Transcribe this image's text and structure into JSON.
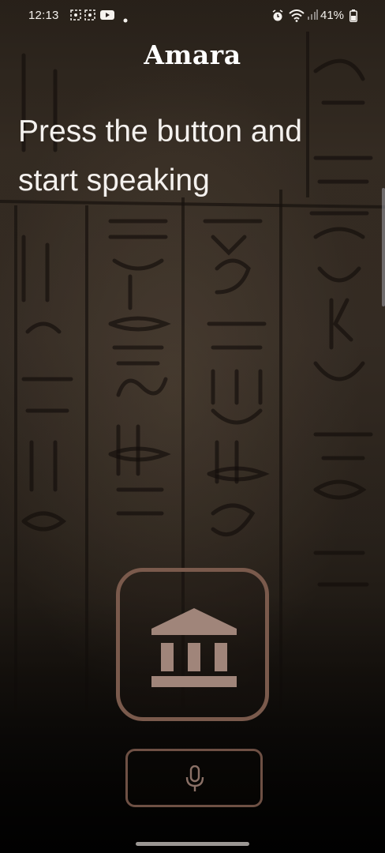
{
  "status_bar": {
    "time": "12:13",
    "battery": "41%",
    "icons": [
      "screen-record-icon",
      "screen-record-icon",
      "youtube-icon",
      "dot-icon",
      "alarm-icon",
      "wifi-icon",
      "signal-icon",
      "battery-icon"
    ]
  },
  "app": {
    "title": "Amara",
    "prompt": "Press the button and start speaking"
  },
  "buttons": {
    "museum": {
      "icon": "museum-icon"
    },
    "mic": {
      "icon": "microphone-icon"
    }
  },
  "colors": {
    "accent": "#7a5a4c",
    "icon_fill": "#a0857a",
    "text": "#f4f1ee"
  }
}
